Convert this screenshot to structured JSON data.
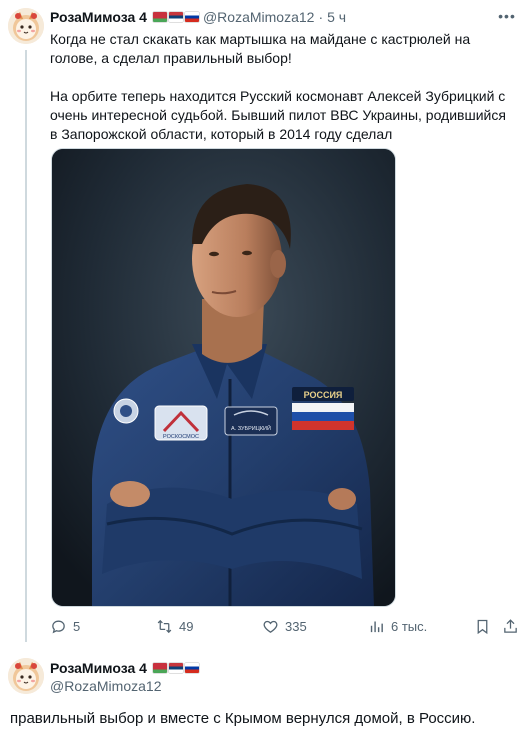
{
  "tweet": {
    "author": {
      "display_name": "РозаМимоза 4",
      "handle": "@RozaMimoza12",
      "flags": [
        "belarus-flag",
        "serbia-flag",
        "russia-flag"
      ]
    },
    "separator": "·",
    "time": "5 ч",
    "text": [
      "Когда не стал скакать как мартышка на майдане с кастрюлей на голове, а сделал правильный выбор!",
      "На орбите теперь находится Русский космонавт Алексей Зубрицкий с очень интересной судьбой. Бывший пилот ВВС Украины, родившийся в Запорожской области, который в 2014 году сделал"
    ],
    "media": {
      "patches": {
        "left": "РОСКОСМОС",
        "center": "А. ЗУБРИЦКИЙ",
        "right": "РОССИЯ"
      }
    },
    "actions": {
      "replies": "5",
      "reposts": "49",
      "likes": "335",
      "views": "6 тыс."
    }
  },
  "reply": {
    "author": {
      "display_name": "РозаМимоза 4",
      "handle": "@RozaMimoza12",
      "flags": [
        "belarus-flag",
        "serbia-flag",
        "russia-flag"
      ]
    },
    "text": "правильный выбор и вместе с Крымом вернулся домой, в Россию."
  },
  "colors": {
    "text_primary": "#0f1419",
    "text_secondary": "#536471",
    "divider": "#cfd9de"
  }
}
